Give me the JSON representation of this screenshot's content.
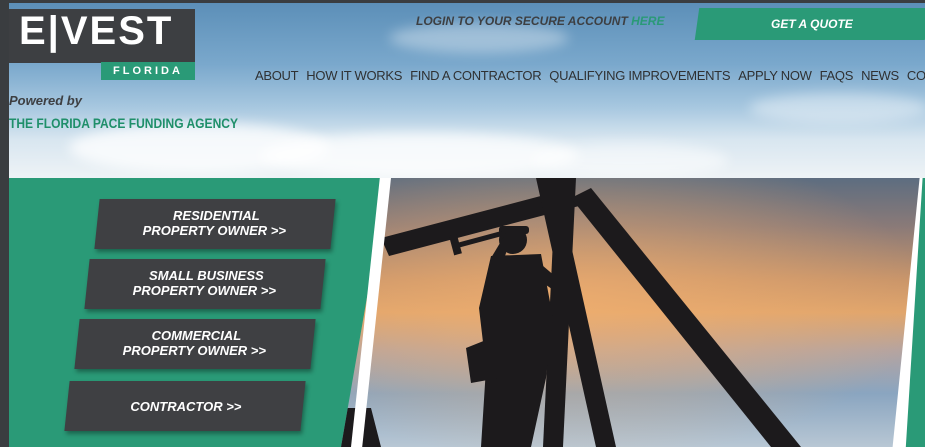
{
  "logo": {
    "main": "E|VEST",
    "sub": "FLORIDA",
    "powered_by": "Powered by",
    "agency": "THE FLORIDA PACE FUNDING AGENCY"
  },
  "login": {
    "text": "LOGIN TO YOUR SECURE ACCOUNT",
    "link": "HERE"
  },
  "quote_button": "GET A QUOTE",
  "nav": [
    "ABOUT",
    "HOW IT WORKS",
    "FIND A CONTRACTOR",
    "QUALIFYING IMPROVEMENTS",
    "APPLY NOW",
    "FAQS",
    "NEWS",
    "CONTACT"
  ],
  "buttons": [
    {
      "line1": "RESIDENTIAL",
      "line2": "PROPERTY OWNER >>"
    },
    {
      "line1": "SMALL BUSINESS",
      "line2": "PROPERTY OWNER >>"
    },
    {
      "line1": "COMMERCIAL",
      "line2": "PROPERTY OWNER >>"
    },
    {
      "line1": "CONTRACTOR >>",
      "line2": ""
    }
  ],
  "colors": {
    "brand_green": "#2a9a77",
    "dark_gray": "#3f4043"
  }
}
